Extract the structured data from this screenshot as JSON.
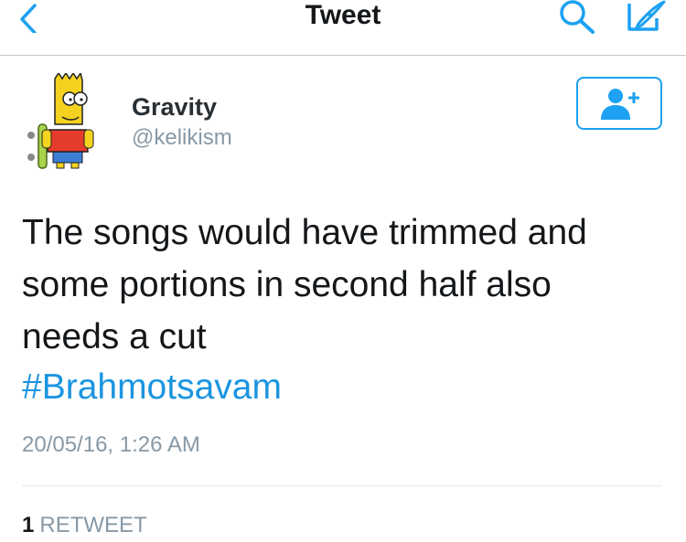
{
  "nav": {
    "title": "Tweet",
    "icons": [
      "chevron-left-icon",
      "search-icon",
      "compose-icon"
    ],
    "accent_color": "#1da1f2"
  },
  "user": {
    "name": "Gravity",
    "handle": "@kelikism",
    "avatar": "cartoon-character-avatar",
    "follow_icon": "add-user-icon"
  },
  "tweet": {
    "text_line_1": "The songs would have trimmed and",
    "text_line_2": "some portions in second half also",
    "text_line_3": "needs a cut",
    "hashtag": "#Brahmotsavam",
    "timestamp": "20/05/16, 1:26 AM"
  },
  "stats": {
    "retweet_count": "1",
    "retweet_label": "RETWEET"
  }
}
